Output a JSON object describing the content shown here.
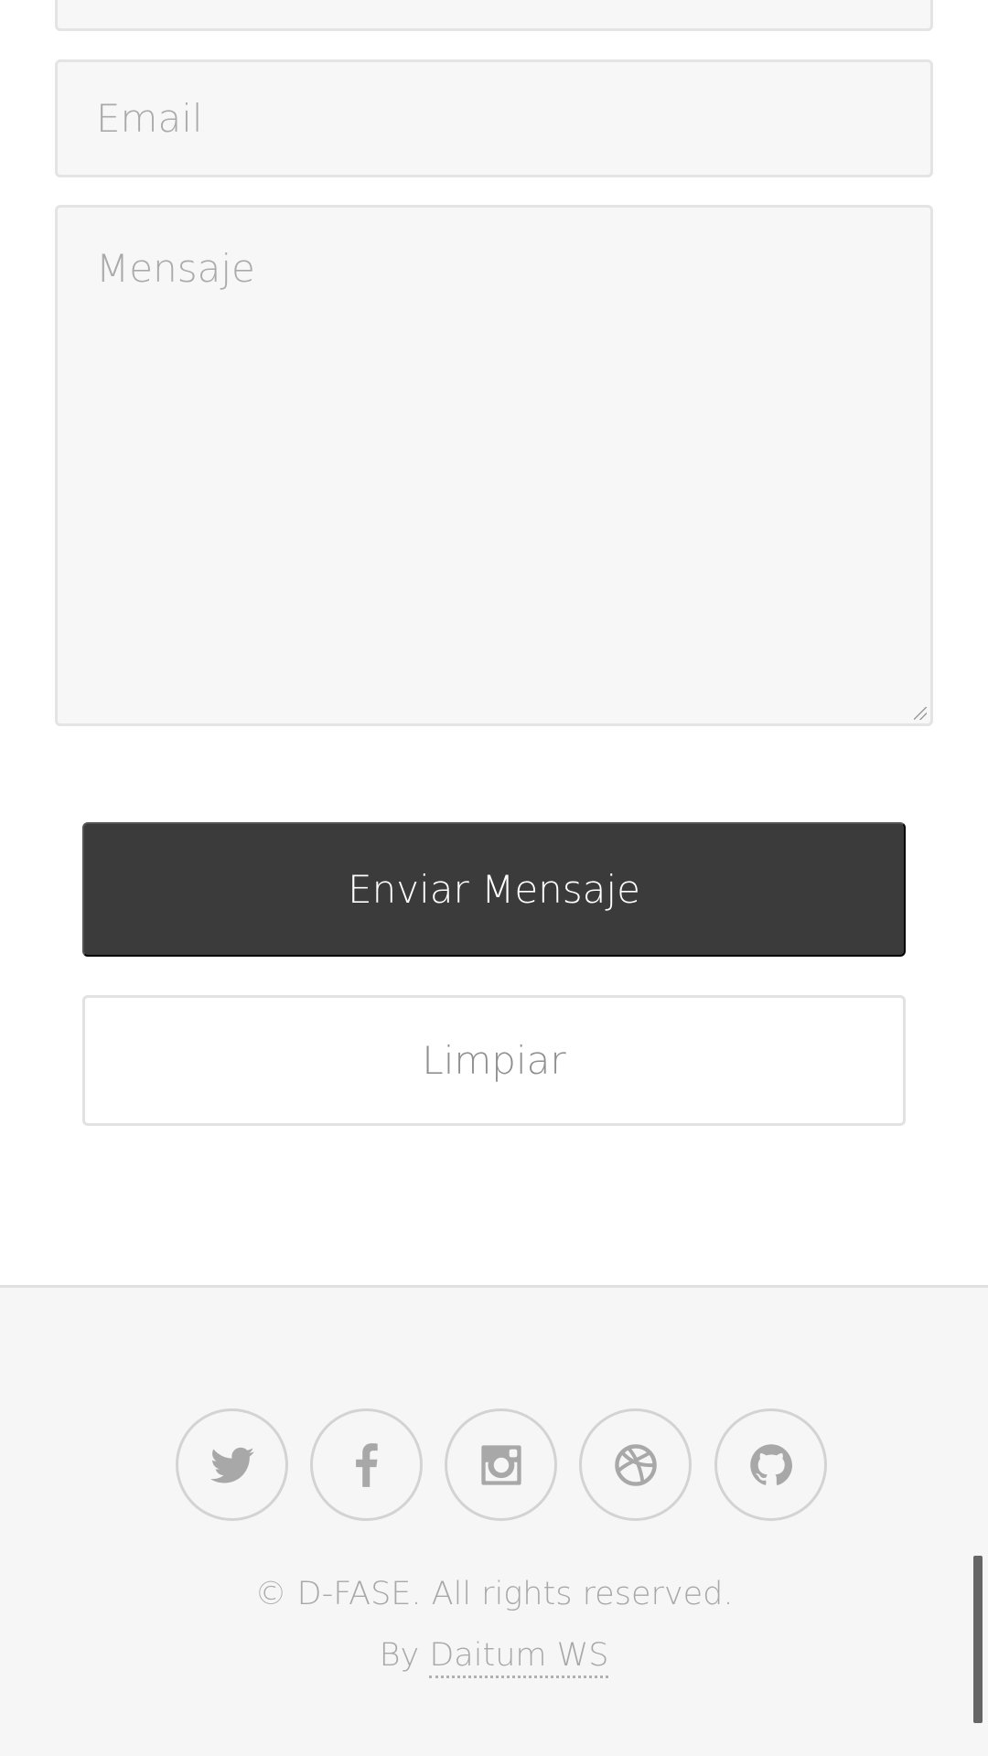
{
  "form": {
    "email_placeholder": "Email",
    "message_placeholder": "Mensaje",
    "send_label": "Enviar Mensaje",
    "clear_label": "Limpiar"
  },
  "footer": {
    "social": [
      {
        "icon": "twitter-icon"
      },
      {
        "icon": "facebook-icon"
      },
      {
        "icon": "instagram-icon"
      },
      {
        "icon": "dribbble-icon"
      },
      {
        "icon": "github-icon"
      }
    ],
    "copyright": "© D-FASE. All rights reserved.",
    "credit_prefix": "By",
    "credit_link": "Daitum WS"
  },
  "colors": {
    "primary_button": "#3b3b3b",
    "field_background": "#f7f7f7",
    "footer_background": "#f6f6f6",
    "muted_text": "#a8a8a8"
  }
}
